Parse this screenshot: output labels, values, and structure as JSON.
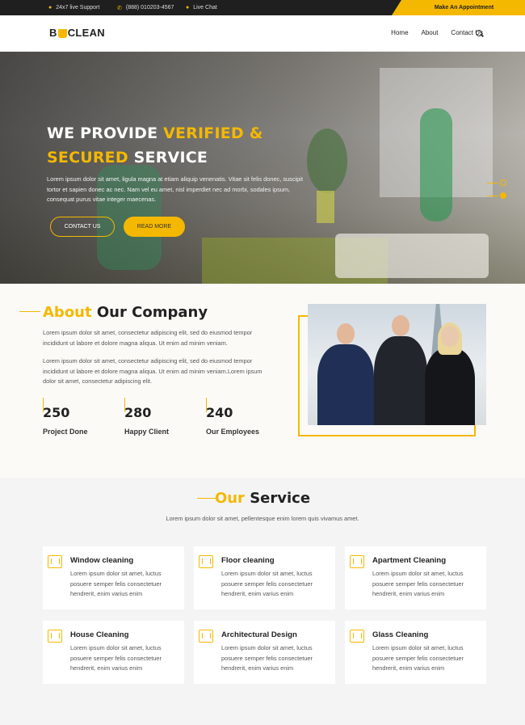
{
  "topbar": {
    "support": "24x7 live Support",
    "phone": "(888) 010203-4567",
    "chat": "Live Chat",
    "appointment": "Make An Appointment"
  },
  "nav": {
    "logo_left": "B",
    "logo_right": "CLEAN",
    "items": [
      "Home",
      "About",
      "Contact Us"
    ]
  },
  "hero": {
    "line1_white": "WE PROVIDE ",
    "line1_yellow": "VERIFIED &",
    "line2_yellow": "SECURED",
    "line2_white": " SERVICE",
    "text": "Lorem ipsum dolor sit amet, ligula magna at etiam aliquip venenatis. Vitae sit felis donec, suscipit tortor et sapien donec ac nec. Nam vel eu amet, nisl imperdiet nec ad morbi, sodales ipsum, consequat purus vitae integer maecenas.",
    "contact_label": "CONTACT US",
    "more_label": "READ MORE"
  },
  "about": {
    "title_yellow": "About",
    "title_dark": " Our Company",
    "p1": "Lorem ipsum dolor sit amet, consectetur adipiscing elit, sed do eiusmod tempor incididunt ut labore et dolore magna aliqua. Ut enim ad minim veniam.",
    "p2": "Lorem ipsum dolor sit amet, consectetur adipiscing elit, sed do eiusmod tempor incididunt ut labore et dolore magna aliqua. Ut enim ad minim veniam.Lorem ipsum dolor sit amet, consectetur adipiscing elit.",
    "stats": [
      {
        "value": "250",
        "label": "Project Done"
      },
      {
        "value": "280",
        "label": "Happy Client"
      },
      {
        "value": "240",
        "label": "Our Employees"
      }
    ]
  },
  "service": {
    "title_yellow": "Our",
    "title_dark": " Service",
    "subtitle": "Lorem ipsum dolor sit amet, pellentesque enim lorem quis vivamus amet.",
    "cards": [
      {
        "title": "Window cleaning",
        "text": "Lorem ipsum dolor sit amet, luctus posuere semper felis consectetuer hendrerit, enim varius enim",
        "icon": "window-icon"
      },
      {
        "title": "Floor cleaning",
        "text": "Lorem ipsum dolor sit amet, luctus posuere semper felis consectetuer hendrerit, enim varius enim",
        "icon": "stairs-icon"
      },
      {
        "title": "Apartment Cleaning",
        "text": "Lorem ipsum dolor sit amet, luctus posuere semper felis consectetuer hendrerit, enim varius enim",
        "icon": "apartment-icon"
      },
      {
        "title": "House Cleaning",
        "text": "Lorem ipsum dolor sit amet, luctus posuere semper felis consectetuer hendrerit, enim varius enim",
        "icon": "house-icon"
      },
      {
        "title": "Architectural Design",
        "text": "Lorem ipsum dolor sit amet, luctus posuere semper felis consectetuer hendrerit, enim varius enim",
        "icon": "design-icon"
      },
      {
        "title": "Glass Cleaning",
        "text": "Lorem ipsum dolor sit amet, luctus posuere semper felis consectetuer hendrerit, enim varius enim",
        "icon": "glass-icon"
      }
    ]
  },
  "colors": {
    "accent": "#f5b800",
    "dark": "#1f1f1f"
  }
}
